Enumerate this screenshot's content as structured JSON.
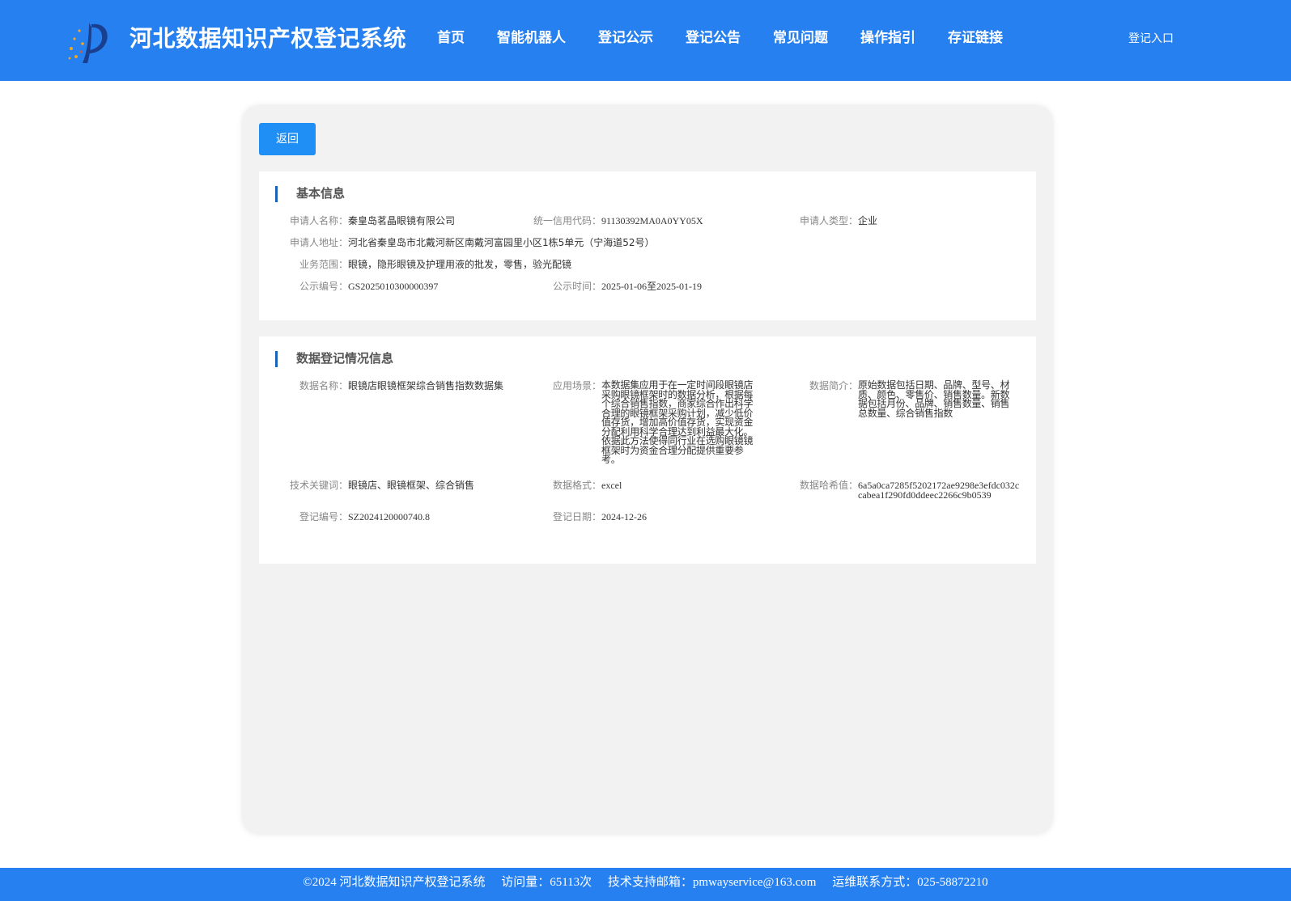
{
  "header": {
    "site_title": "河北数据知识产权登记系统",
    "nav": [
      "首页",
      "智能机器人",
      "登记公示",
      "登记公告",
      "常见问题",
      "操作指引",
      "存证链接"
    ],
    "login_label": "登记入口"
  },
  "back_label": "返回",
  "basic": {
    "title": "基本信息",
    "applicant_name_label": "申请人名称：",
    "applicant_name": "秦皇岛茗晶眼镜有限公司",
    "credit_code_label": "统一信用代码：",
    "credit_code": "91130392MA0A0YY05X",
    "applicant_type_label": "申请人类型：",
    "applicant_type": "企业",
    "address_label": "申请人地址：",
    "address": "河北省秦皇岛市北戴河新区南戴河富园里小区1栋5单元（宁海道52号）",
    "scope_label": "业务范围：",
    "scope": "眼镜，隐形眼镜及护理用液的批发，零售，验光配镜",
    "notice_no_label": "公示编号：",
    "notice_no": "GS2025010300000397",
    "notice_time_label": "公示时间：",
    "notice_time": "2025-01-06至2025-01-19"
  },
  "data_reg": {
    "title": "数据登记情况信息",
    "data_name_label": "数据名称：",
    "data_name": "眼镜店眼镜框架综合销售指数数据集",
    "scenario_label": "应用场景：",
    "scenario": "本数据集应用于在一定时间段眼镜店采购眼镜框架时的数据分析，根据每个综合销售指数，商家综合作出科学合理的眼镜框架采购计划，减少低价值存货，增加高价值存货，实现资金分配利用科学合理达到利益最大化。依据此方法使得同行业在选购眼镜镜框架时为资金合理分配提供重要参考。",
    "intro_label": "数据简介：",
    "intro": "原始数据包括日期、品牌、型号、材质、颜色、零售价、销售数量。新数据包括月份、品牌、销售数量、销售总数量、综合销售指数",
    "keywords_label": "技术关键词：",
    "keywords": "眼镜店、眼镜框架、综合销售",
    "format_label": "数据格式：",
    "format": "excel",
    "hash_label": "数据哈希值：",
    "hash": "6a5a0ca7285f5202172ae9298e3efdc032ccabea1f290fd0ddeec2266c9b0539",
    "reg_no_label": "登记编号：",
    "reg_no": "SZ2024120000740.8",
    "reg_date_label": "登记日期：",
    "reg_date": "2024-12-26"
  },
  "footer": {
    "copyright": "©2024 河北数据知识产权登记系统",
    "visits": "访问量：65113次",
    "email": "技术支持邮箱：pmwayservice@163.com",
    "contact": "运维联系方式：025-58872210"
  }
}
